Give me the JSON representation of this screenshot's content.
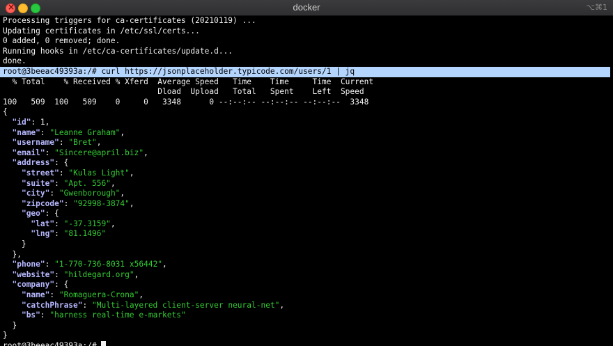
{
  "window": {
    "title": "docker",
    "shortcut": "⌥⌘1"
  },
  "terminal": {
    "lines": [
      {
        "spans": [
          {
            "t": "Processing triggers for ca-certificates (20210119) ..."
          }
        ]
      },
      {
        "spans": [
          {
            "t": "Updating certificates in /etc/ssl/certs..."
          }
        ]
      },
      {
        "spans": [
          {
            "t": "0 added, 0 removed; done."
          }
        ]
      },
      {
        "spans": [
          {
            "t": "Running hooks in /etc/ca-certificates/update.d..."
          }
        ]
      },
      {
        "spans": [
          {
            "t": "done."
          }
        ]
      },
      {
        "selected": true,
        "spans": [
          {
            "t": "root@3beeac49393a:/# curl https://jsonplaceholder.typicode.com/users/1 | jq"
          }
        ]
      },
      {
        "spans": [
          {
            "t": "  % Total    % Received % Xferd  Average Speed   Time    Time     Time  Current"
          }
        ]
      },
      {
        "spans": [
          {
            "t": "                                 Dload  Upload   Total   Spent    Left  Speed"
          }
        ]
      },
      {
        "spans": [
          {
            "t": "100   509  100   509    0     0   3348      0 --:--:-- --:--:-- --:--:--  3348"
          }
        ]
      },
      {
        "spans": [
          {
            "t": "{"
          }
        ]
      },
      {
        "spans": [
          {
            "t": "  "
          },
          {
            "t": "\"id\"",
            "c": "k"
          },
          {
            "t": ": 1,"
          }
        ]
      },
      {
        "spans": [
          {
            "t": "  "
          },
          {
            "t": "\"name\"",
            "c": "k"
          },
          {
            "t": ": "
          },
          {
            "t": "\"Leanne Graham\"",
            "c": "s"
          },
          {
            "t": ","
          }
        ]
      },
      {
        "spans": [
          {
            "t": "  "
          },
          {
            "t": "\"username\"",
            "c": "k"
          },
          {
            "t": ": "
          },
          {
            "t": "\"Bret\"",
            "c": "s"
          },
          {
            "t": ","
          }
        ]
      },
      {
        "spans": [
          {
            "t": "  "
          },
          {
            "t": "\"email\"",
            "c": "k"
          },
          {
            "t": ": "
          },
          {
            "t": "\"Sincere@april.biz\"",
            "c": "s"
          },
          {
            "t": ","
          }
        ]
      },
      {
        "spans": [
          {
            "t": "  "
          },
          {
            "t": "\"address\"",
            "c": "k"
          },
          {
            "t": ": {"
          }
        ]
      },
      {
        "spans": [
          {
            "t": "    "
          },
          {
            "t": "\"street\"",
            "c": "k"
          },
          {
            "t": ": "
          },
          {
            "t": "\"Kulas Light\"",
            "c": "s"
          },
          {
            "t": ","
          }
        ]
      },
      {
        "spans": [
          {
            "t": "    "
          },
          {
            "t": "\"suite\"",
            "c": "k"
          },
          {
            "t": ": "
          },
          {
            "t": "\"Apt. 556\"",
            "c": "s"
          },
          {
            "t": ","
          }
        ]
      },
      {
        "spans": [
          {
            "t": "    "
          },
          {
            "t": "\"city\"",
            "c": "k"
          },
          {
            "t": ": "
          },
          {
            "t": "\"Gwenborough\"",
            "c": "s"
          },
          {
            "t": ","
          }
        ]
      },
      {
        "spans": [
          {
            "t": "    "
          },
          {
            "t": "\"zipcode\"",
            "c": "k"
          },
          {
            "t": ": "
          },
          {
            "t": "\"92998-3874\"",
            "c": "s"
          },
          {
            "t": ","
          }
        ]
      },
      {
        "spans": [
          {
            "t": "    "
          },
          {
            "t": "\"geo\"",
            "c": "k"
          },
          {
            "t": ": {"
          }
        ]
      },
      {
        "spans": [
          {
            "t": "      "
          },
          {
            "t": "\"lat\"",
            "c": "k"
          },
          {
            "t": ": "
          },
          {
            "t": "\"-37.3159\"",
            "c": "s"
          },
          {
            "t": ","
          }
        ]
      },
      {
        "spans": [
          {
            "t": "      "
          },
          {
            "t": "\"lng\"",
            "c": "k"
          },
          {
            "t": ": "
          },
          {
            "t": "\"81.1496\"",
            "c": "s"
          }
        ]
      },
      {
        "spans": [
          {
            "t": "    }"
          }
        ]
      },
      {
        "spans": [
          {
            "t": "  },"
          }
        ]
      },
      {
        "spans": [
          {
            "t": "  "
          },
          {
            "t": "\"phone\"",
            "c": "k"
          },
          {
            "t": ": "
          },
          {
            "t": "\"1-770-736-8031 x56442\"",
            "c": "s"
          },
          {
            "t": ","
          }
        ]
      },
      {
        "spans": [
          {
            "t": "  "
          },
          {
            "t": "\"website\"",
            "c": "k"
          },
          {
            "t": ": "
          },
          {
            "t": "\"hildegard.org\"",
            "c": "s"
          },
          {
            "t": ","
          }
        ]
      },
      {
        "spans": [
          {
            "t": "  "
          },
          {
            "t": "\"company\"",
            "c": "k"
          },
          {
            "t": ": {"
          }
        ]
      },
      {
        "spans": [
          {
            "t": "    "
          },
          {
            "t": "\"name\"",
            "c": "k"
          },
          {
            "t": ": "
          },
          {
            "t": "\"Romaguera-Crona\"",
            "c": "s"
          },
          {
            "t": ","
          }
        ]
      },
      {
        "spans": [
          {
            "t": "    "
          },
          {
            "t": "\"catchPhrase\"",
            "c": "k"
          },
          {
            "t": ": "
          },
          {
            "t": "\"Multi-layered client-server neural-net\"",
            "c": "s"
          },
          {
            "t": ","
          }
        ]
      },
      {
        "spans": [
          {
            "t": "    "
          },
          {
            "t": "\"bs\"",
            "c": "k"
          },
          {
            "t": ": "
          },
          {
            "t": "\"harness real-time e-markets\"",
            "c": "s"
          }
        ]
      },
      {
        "spans": [
          {
            "t": "  }"
          }
        ]
      },
      {
        "spans": [
          {
            "t": "}"
          }
        ]
      },
      {
        "prompt": true,
        "spans": [
          {
            "t": "root@3beeac49393a:/# "
          }
        ]
      }
    ]
  },
  "colors": {
    "background": "#000000",
    "text": "#f2f2f2",
    "json_key": "#b7b8ff",
    "json_string": "#33cc33",
    "selection": "#b4d5fe"
  }
}
